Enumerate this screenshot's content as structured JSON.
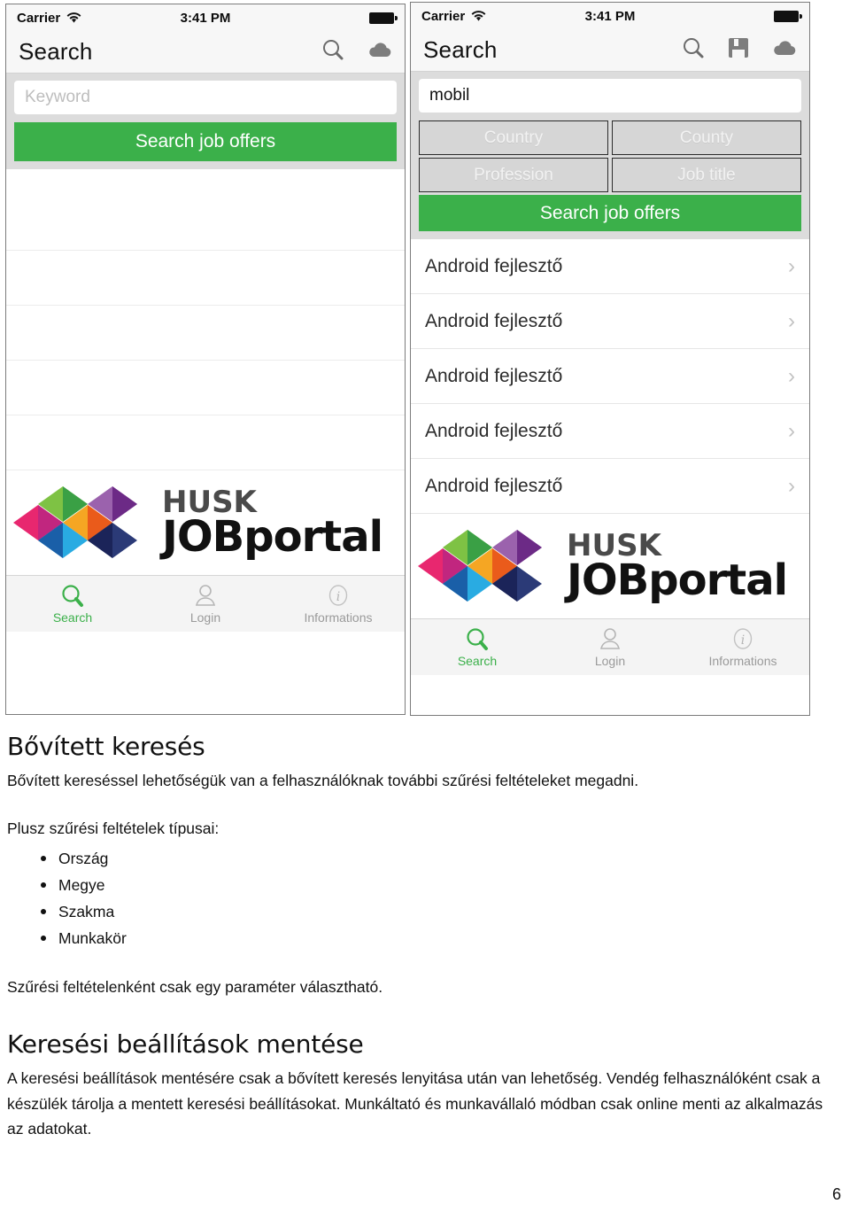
{
  "screenshots": {
    "left_phone": {
      "status_bar": {
        "carrier": "Carrier",
        "time": "3:41 PM",
        "wifi_icon": "wifi-icon",
        "battery_icon": "battery-full-icon"
      },
      "nav": {
        "title": "Search",
        "icons": [
          "search-icon",
          "cloud-icon"
        ]
      },
      "keyword_field": {
        "value": "",
        "placeholder": "Keyword"
      },
      "search_button": "Search job offers",
      "empty_rows": 5
    },
    "right_phone": {
      "status_bar": {
        "carrier": "Carrier",
        "time": "3:41 PM",
        "wifi_icon": "wifi-icon",
        "battery_icon": "battery-full-icon"
      },
      "nav": {
        "title": "Search",
        "icons": [
          "search-icon",
          "save-icon",
          "cloud-icon"
        ]
      },
      "keyword_field": {
        "value": "mobil",
        "placeholder": "Keyword"
      },
      "filters": [
        {
          "label": "Country",
          "name": "country"
        },
        {
          "label": "County",
          "name": "county"
        },
        {
          "label": "Profession",
          "name": "profession"
        },
        {
          "label": "Job title",
          "name": "job-title"
        }
      ],
      "search_button": "Search job offers",
      "results": [
        {
          "title": "Android fejlesztő"
        },
        {
          "title": "Android fejlesztő"
        },
        {
          "title": "Android fejlesztő"
        },
        {
          "title": "Android fejlesztő"
        },
        {
          "title": "Android fejlesztő"
        }
      ],
      "chevron": "›"
    },
    "branding": {
      "name_top": "HUSK",
      "name_bottom": "JOBportal"
    },
    "tab_bar": [
      {
        "label": "Search",
        "icon": "search-icon",
        "active": true
      },
      {
        "label": "Login",
        "icon": "person-icon",
        "active": false
      },
      {
        "label": "Informations",
        "icon": "info-icon",
        "active": false
      }
    ],
    "colors": {
      "accent_green": "#3bb04a",
      "panel_gray": "#dcdcdc",
      "nav_bg": "#f7f7f7",
      "logo_pink": "#e8276f",
      "logo_magenta": "#c1267f",
      "logo_green_light": "#7ec244",
      "logo_green_dark": "#3aa045",
      "logo_purple_light": "#9b62ad",
      "logo_purple_dark": "#6c2a86",
      "logo_orange": "#f5a623",
      "logo_red_orange": "#ea5b1b",
      "logo_blue_light": "#29abe2",
      "logo_blue_dark": "#1a5fa8",
      "logo_navy_light": "#2b3a77",
      "logo_navy_dark": "#1b2459"
    }
  },
  "document": {
    "heading_1": "Bővített keresés",
    "paragraph_1": "Bővített kereséssel lehetőségük van a felhasználóknak további szűrési feltételeket megadni.",
    "list_intro": "Plusz szűrési feltételek típusai:",
    "list_items": [
      "Ország",
      "Megye",
      "Szakma",
      "Munkakör"
    ],
    "paragraph_2": "Szűrési feltételenként csak egy paraméter választható.",
    "heading_2": "Keresési beállítások mentése",
    "paragraph_3": "A keresési beállítások mentésére csak a bővített keresés lenyitása után van lehetőség. Vendég felhasználóként csak a készülék tárolja a mentett keresési beállításokat. Munkáltató és munkavállaló módban csak online menti az alkalmazás az adatokat.",
    "page_number": "6"
  }
}
